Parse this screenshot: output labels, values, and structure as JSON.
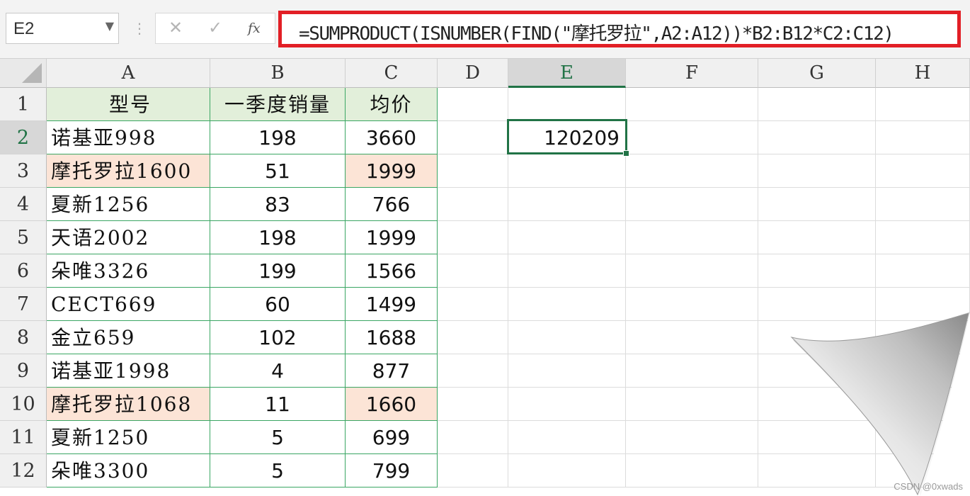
{
  "name_box": "E2",
  "formula": "=SUMPRODUCT(ISNUMBER(FIND(\"摩托罗拉\",A2:A12))*B2:B12*C2:C12)",
  "formula_buttons": {
    "cancel": "✕",
    "enter": "✓",
    "fx": "fx"
  },
  "columns": [
    "A",
    "B",
    "C",
    "D",
    "E",
    "F",
    "G",
    "H"
  ],
  "rows": [
    "1",
    "2",
    "3",
    "4",
    "5",
    "6",
    "7",
    "8",
    "9",
    "10",
    "11",
    "12"
  ],
  "table": {
    "headers": [
      "型号",
      "一季度销量",
      "均价"
    ],
    "data": [
      [
        "诺基亚998",
        "198",
        "3660"
      ],
      [
        "摩托罗拉1600",
        "51",
        "1999"
      ],
      [
        "夏新1256",
        "83",
        "766"
      ],
      [
        "天语2002",
        "198",
        "1999"
      ],
      [
        "朵唯3326",
        "199",
        "1566"
      ],
      [
        "CECT669",
        "60",
        "1499"
      ],
      [
        "金立659",
        "102",
        "1688"
      ],
      [
        "诺基亚1998",
        "4",
        "877"
      ],
      [
        "摩托罗拉1068",
        "11",
        "1660"
      ],
      [
        "夏新1250",
        "5",
        "699"
      ],
      [
        "朵唯3300",
        "5",
        "799"
      ]
    ]
  },
  "highlighted_rows": [
    "3",
    "10"
  ],
  "result_cell": {
    "ref": "E2",
    "value": "120209"
  },
  "colors": {
    "header_fill": "#e2efda",
    "highlight_fill": "#fce4d6",
    "formula_border": "#e21f26",
    "active": "#217346"
  },
  "watermark": "CSDN @0xwads"
}
